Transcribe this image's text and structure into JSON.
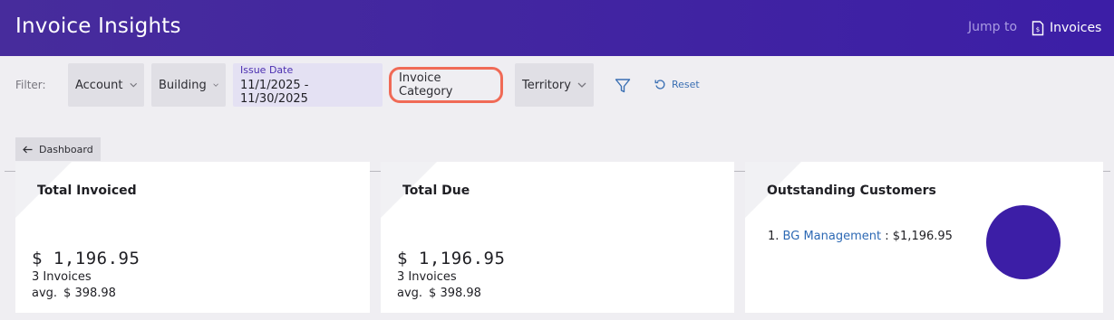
{
  "header": {
    "title": "Invoice Insights",
    "jump_to": "Jump to",
    "jump_target": "Invoices"
  },
  "filters": {
    "label": "Filter:",
    "account": "Account",
    "building": "Building",
    "issue_date_label": "Issue Date",
    "issue_date_value": "11/1/2025 - 11/30/2025",
    "invoice_category": "Invoice Category",
    "territory": "Territory",
    "reset": "Reset"
  },
  "nav": {
    "back": "Dashboard"
  },
  "cards": {
    "total_invoiced": {
      "title": "Total Invoiced",
      "amount": "$ 1,196.95",
      "count": "3 Invoices",
      "avg_label": "avg.",
      "avg_value": "$  398.98"
    },
    "total_due": {
      "title": "Total Due",
      "amount": "$ 1,196.95",
      "count": "3 Invoices",
      "avg_label": "avg.",
      "avg_value": "$  398.98"
    },
    "outstanding": {
      "title": "Outstanding Customers",
      "rank": "1.",
      "customer": "BG Management",
      "separator": ":",
      "amount": "$1,196.95"
    }
  },
  "colors": {
    "header_bg": "#3c1ea6",
    "highlight_border": "#f06a56",
    "link": "#2d69b4",
    "pie_fill": "#3c1ea6"
  },
  "icons": {
    "jump": "document-icon",
    "chevron": "chevron-down-icon",
    "funnel": "filter-icon",
    "reset": "reset-icon",
    "back": "arrow-left-icon"
  }
}
